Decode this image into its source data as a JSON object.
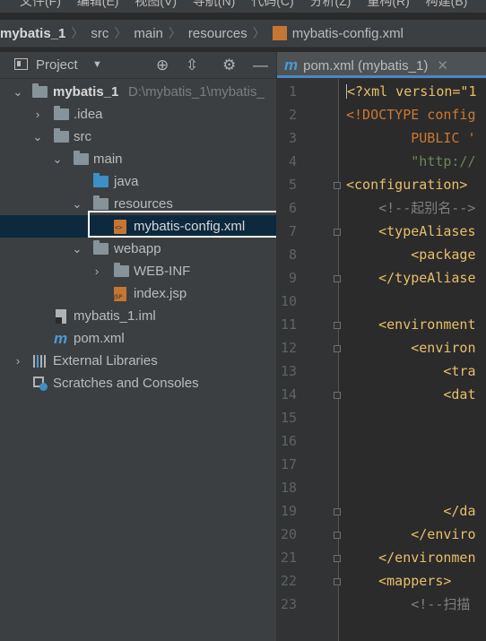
{
  "menubar": {
    "items": [
      "文件(F)",
      "编辑(E)",
      "视图(V)",
      "导航(N)",
      "代码(C)",
      "分析(Z)",
      "重构(R)",
      "构建(B)"
    ]
  },
  "breadcrumb": {
    "items": [
      "mybatis_1",
      "src",
      "main",
      "resources"
    ],
    "file": "mybatis-config.xml"
  },
  "project_panel": {
    "title": "Project"
  },
  "tree": [
    {
      "label": "mybatis_1",
      "path": "D:\\mybatis_1\\mybatis_",
      "indent": 0
    },
    {
      "label": ".idea"
    },
    {
      "label": "src"
    },
    {
      "label": "main"
    },
    {
      "label": "java"
    },
    {
      "label": "resources"
    },
    {
      "label": "mybatis-config.xml"
    },
    {
      "label": "webapp"
    },
    {
      "label": "WEB-INF"
    },
    {
      "label": "index.jsp"
    },
    {
      "label": "mybatis_1.iml"
    },
    {
      "label": "pom.xml"
    },
    {
      "label": "External Libraries"
    },
    {
      "label": "Scratches and Consoles"
    }
  ],
  "editor": {
    "tab": {
      "label": "pom.xml (mybatis_1)",
      "icon": "m"
    },
    "line_numbers": [
      "1",
      "2",
      "3",
      "4",
      "5",
      "6",
      "7",
      "8",
      "9",
      "10",
      "11",
      "12",
      "13",
      "14",
      "15",
      "16",
      "17",
      "18",
      "19",
      "20",
      "21",
      "22",
      "23"
    ],
    "lines": {
      "l1a": "<?xml version=\"1",
      "l2a": "<!DOCTYPE config",
      "l3a": "        PUBLIC '",
      "l4a": "        \"http://",
      "l5a": "<configuration>",
      "l6a": "    <!--起别名-->",
      "l7a": "    <typeAliases",
      "l8a": "        <package",
      "l9a": "    </typeAliase",
      "l11a": "    <environment",
      "l12a": "        <environ",
      "l13a": "            <tra",
      "l14a": "            <dat",
      "l19a": "            </da",
      "l20a": "        </enviro",
      "l21a": "    </environmen",
      "l22a": "    <mappers>",
      "l23a": "        <!--扫描"
    }
  }
}
